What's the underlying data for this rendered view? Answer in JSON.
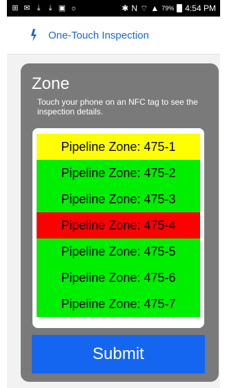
{
  "status_bar": {
    "battery": "79%",
    "time": "4:54 PM",
    "icons": [
      "plus-icon",
      "mail-icon",
      "download-icon",
      "download-icon",
      "gallery-icon",
      "weather-icon",
      "bluetooth-icon",
      "nfc-icon",
      "wifi-icon",
      "signal-icon",
      "battery-icon"
    ]
  },
  "header": {
    "app_title": "One-Touch Inspection",
    "logo_icon": "pipeline-logo-icon",
    "accent_color": "#1565d8"
  },
  "zone_card": {
    "title": "Zone",
    "description": "Touch your phone on an NFC tag to see the inspection details.",
    "items": [
      {
        "label": "Pipeline Zone: 475-1",
        "status_color": "#ffff00"
      },
      {
        "label": "Pipeline Zone: 475-2",
        "status_color": "#00ee00"
      },
      {
        "label": "Pipeline Zone: 475-3",
        "status_color": "#00ee00"
      },
      {
        "label": "Pipeline Zone: 475-4",
        "status_color": "#ff0000"
      },
      {
        "label": "Pipeline Zone: 475-5",
        "status_color": "#00ee00"
      },
      {
        "label": "Pipeline Zone: 475-6",
        "status_color": "#00ee00"
      },
      {
        "label": "Pipeline Zone: 475-7",
        "status_color": "#00ee00"
      }
    ],
    "submit_label": "Submit"
  }
}
